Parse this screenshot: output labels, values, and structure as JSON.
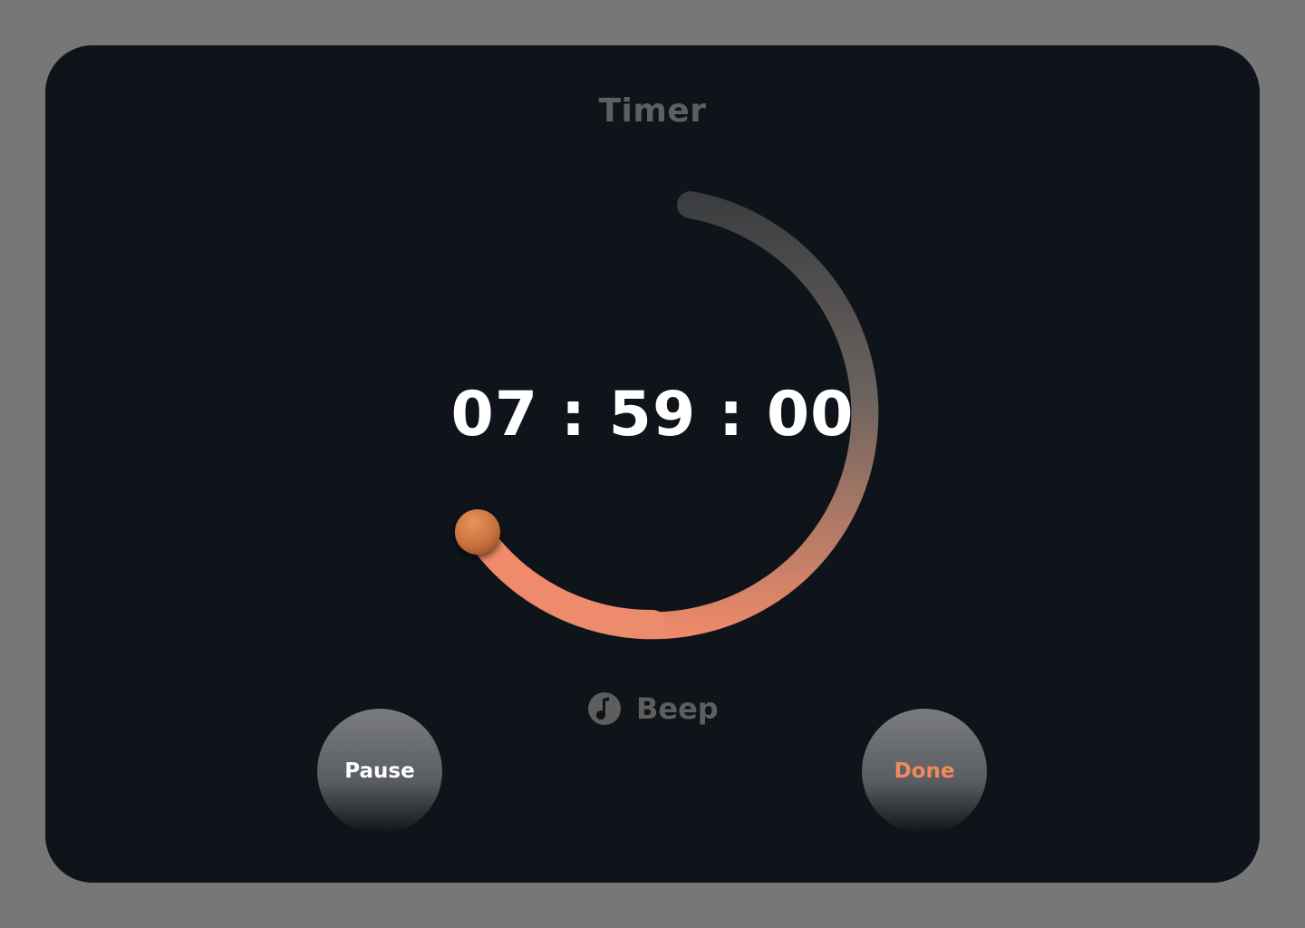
{
  "header": {
    "title": "Timer"
  },
  "timer": {
    "display": "07 : 59 : 00",
    "progress_fraction": 0.54
  },
  "sound": {
    "icon": "music-note-icon",
    "label": "Beep"
  },
  "controls": {
    "pause_label": "Pause",
    "done_label": "Done"
  },
  "colors": {
    "background": "#777777",
    "card": "#0e141a",
    "accent": "#f08a6a",
    "knob": "#d07840"
  }
}
